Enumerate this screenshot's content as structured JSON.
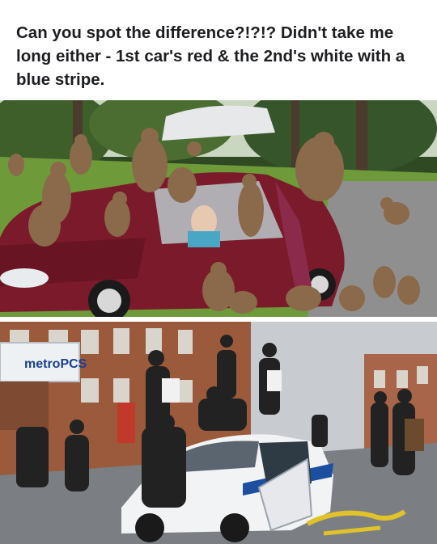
{
  "post": {
    "caption": "Can you spot the difference?!?!? Didn't take me long either - 1st car's red & the 2nd's white with a blue stripe."
  },
  "images": {
    "top": {
      "subject": "baboons-on-red-car"
    },
    "bottom": {
      "subject": "people-on-white-police-car",
      "store_sign_text": "metroPCS"
    }
  },
  "colors": {
    "car_top": "#7a1a2a",
    "car_bottom": "#f2f3f5",
    "police_stripe": "#1d4fa0",
    "grass": "#6f9a3a",
    "brick": "#9b5a3c"
  }
}
